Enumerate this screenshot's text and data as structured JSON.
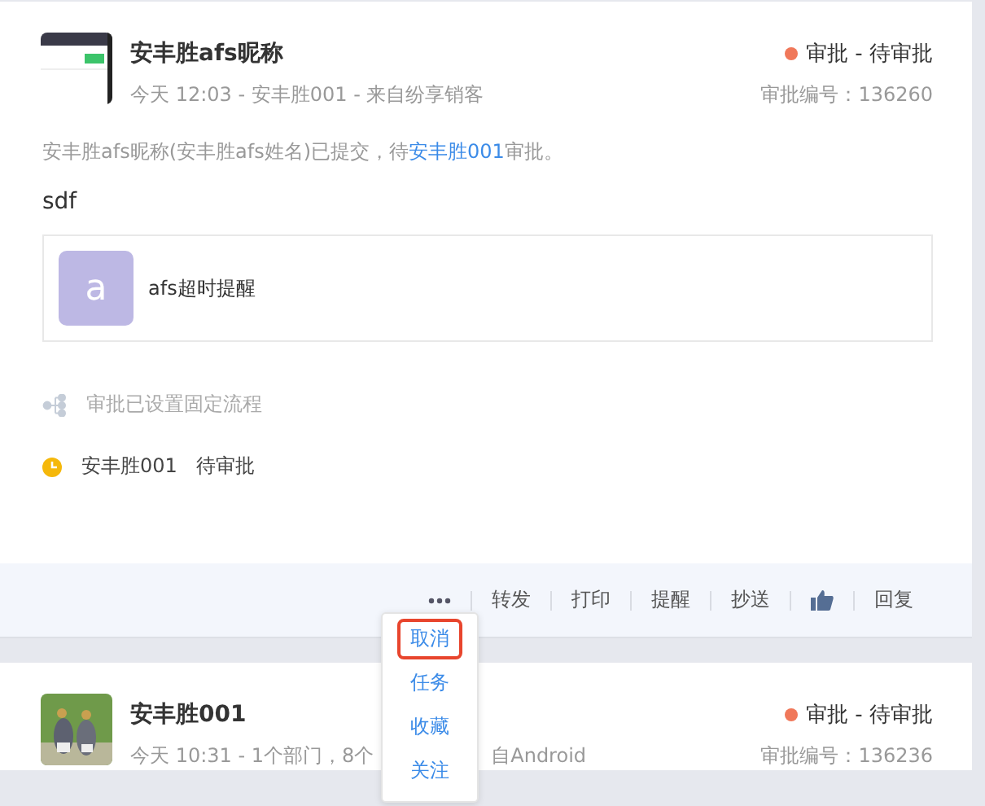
{
  "cards": [
    {
      "thumbnail": {
        "kind": "app"
      },
      "title": "安丰胜afs昵称",
      "meta": [
        "今天 12:03 - 安丰胜001 - 来自纷享销客"
      ],
      "status": "审批 - 待审批",
      "number": "审批编号：136260",
      "description": {
        "before": "安丰胜afs昵称(安丰胜afs姓名)已提交，待",
        "link": "安丰胜001",
        "after": "审批。"
      },
      "content": "sdf",
      "attachment": {
        "initial": "a",
        "name": "afs超时提醒"
      },
      "flow_note": "审批已设置固定流程",
      "approver": {
        "name": "安丰胜001",
        "state": "待审批"
      },
      "actions": [
        {
          "kind": "more"
        },
        {
          "kind": "text",
          "label": "转发"
        },
        {
          "kind": "text",
          "label": "打印"
        },
        {
          "kind": "text",
          "label": "提醒"
        },
        {
          "kind": "text",
          "label": "抄送"
        },
        {
          "kind": "like"
        },
        {
          "kind": "text",
          "label": "回复"
        }
      ]
    },
    {
      "title": "安丰胜001",
      "meta": [
        "今天 10:31 - 1个部门，8个",
        "自Android"
      ],
      "status": "审批 - 待审批",
      "number": "审批编号：136236"
    }
  ],
  "menu": [
    {
      "label": "取消",
      "selected": true
    },
    {
      "label": "任务",
      "selected": false
    },
    {
      "label": "收藏",
      "selected": false
    },
    {
      "label": "关注",
      "selected": false
    }
  ]
}
